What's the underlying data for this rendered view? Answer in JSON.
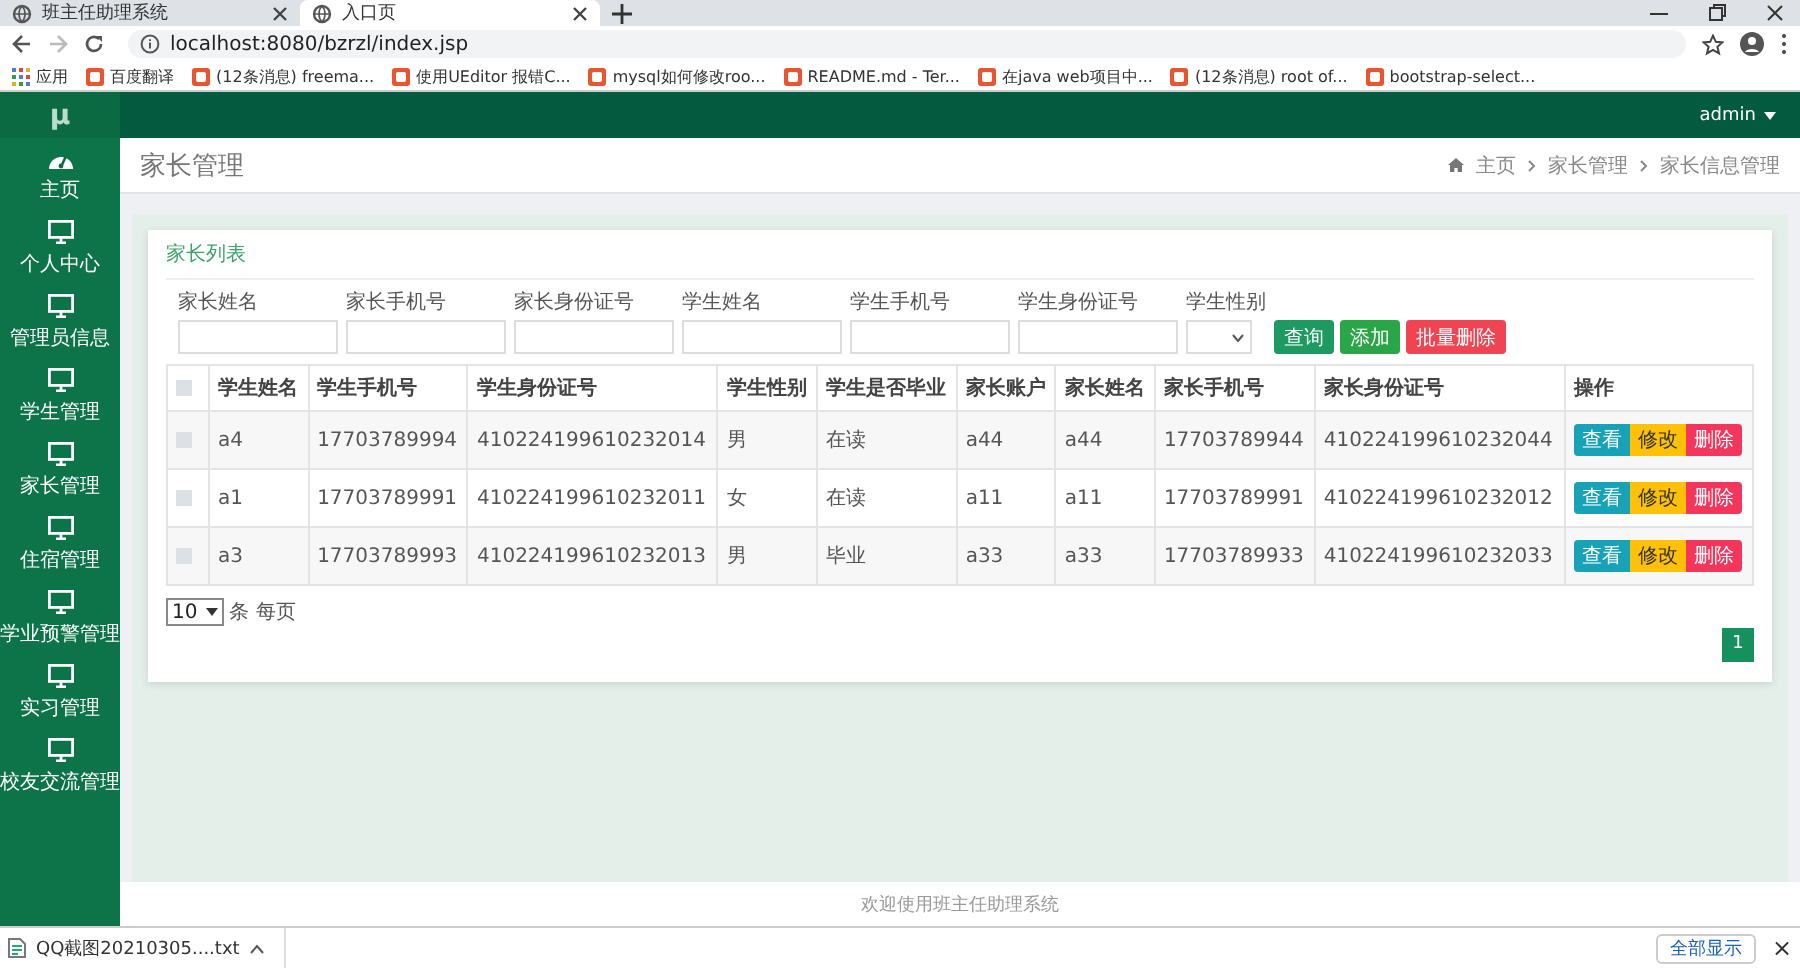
{
  "browser": {
    "tabs": [
      {
        "title": "班主任助理系统",
        "selected": false
      },
      {
        "title": "入口页",
        "selected": true
      }
    ],
    "url": "localhost:8080/bzrzl/index.jsp",
    "bookmarks": [
      {
        "label": "应用",
        "kind": "apps"
      },
      {
        "label": "百度翻译",
        "kind": "site"
      },
      {
        "label": "(12条消息) freema...",
        "kind": "site"
      },
      {
        "label": "使用UEditor 报错C...",
        "kind": "site"
      },
      {
        "label": "mysql如何修改roo...",
        "kind": "site"
      },
      {
        "label": "README.md - Ter...",
        "kind": "site"
      },
      {
        "label": "在java web项目中...",
        "kind": "site"
      },
      {
        "label": "(12条消息) root of...",
        "kind": "site"
      },
      {
        "label": "bootstrap-select...",
        "kind": "site"
      }
    ]
  },
  "app": {
    "logo": "μ",
    "user": "admin",
    "sidebar": {
      "items": [
        {
          "label": "主页",
          "kind": "dashboard"
        },
        {
          "label": "个人中心",
          "kind": "monitor"
        },
        {
          "label": "管理员信息",
          "kind": "monitor"
        },
        {
          "label": "学生管理",
          "kind": "monitor"
        },
        {
          "label": "家长管理",
          "kind": "monitor"
        },
        {
          "label": "住宿管理",
          "kind": "monitor"
        },
        {
          "label": "学业预警管理",
          "kind": "monitor"
        },
        {
          "label": "实习管理",
          "kind": "monitor"
        },
        {
          "label": "校友交流管理",
          "kind": "monitor"
        }
      ]
    },
    "page_title": "家长管理",
    "breadcrumb": [
      "主页",
      "家长管理",
      "家长信息管理"
    ],
    "card_title": "家长列表",
    "filters": [
      {
        "label": "家长姓名",
        "kind": "text"
      },
      {
        "label": "家长手机号",
        "kind": "text"
      },
      {
        "label": "家长身份证号",
        "kind": "text"
      },
      {
        "label": "学生姓名",
        "kind": "text"
      },
      {
        "label": "学生手机号",
        "kind": "text"
      },
      {
        "label": "学生身份证号",
        "kind": "text"
      },
      {
        "label": "学生性别",
        "kind": "select"
      }
    ],
    "filter_buttons": [
      {
        "label": "查询",
        "kind": "query"
      },
      {
        "label": "添加",
        "kind": "add"
      },
      {
        "label": "批量删除",
        "kind": "delete"
      }
    ],
    "table": {
      "header_checked": false,
      "columns": [
        "学生姓名",
        "学生手机号",
        "学生身份证号",
        "学生性别",
        "学生是否毕业",
        "家长账户",
        "家长姓名",
        "家长手机号",
        "家长身份证号",
        "操作"
      ],
      "rows": [
        {
          "checked": false,
          "cells": [
            "a4",
            "17703789994",
            "410224199610232014",
            "男",
            "在读",
            "a44",
            "a44",
            "17703789944",
            "410224199610232044"
          ],
          "actions": [
            {
              "label": "查看",
              "kind": "view"
            },
            {
              "label": "修改",
              "kind": "edit"
            },
            {
              "label": "删除",
              "kind": "delete"
            }
          ]
        },
        {
          "checked": false,
          "cells": [
            "a1",
            "17703789991",
            "410224199610232011",
            "女",
            "在读",
            "a11",
            "a11",
            "17703789991",
            "410224199610232012"
          ],
          "actions": [
            {
              "label": "查看",
              "kind": "view"
            },
            {
              "label": "修改",
              "kind": "edit"
            },
            {
              "label": "删除",
              "kind": "delete"
            }
          ]
        },
        {
          "checked": false,
          "cells": [
            "a3",
            "17703789993",
            "410224199610232013",
            "男",
            "毕业",
            "a33",
            "a33",
            "17703789933",
            "410224199610232033"
          ],
          "actions": [
            {
              "label": "查看",
              "kind": "view"
            },
            {
              "label": "修改",
              "kind": "edit"
            },
            {
              "label": "删除",
              "kind": "delete"
            }
          ]
        }
      ]
    },
    "page_size": "10",
    "page_size_label": "条 每页",
    "pages": [
      {
        "label": "1",
        "selected": true
      }
    ],
    "footer": "欢迎使用班主任助理系统"
  },
  "download_bar": {
    "file": "QQ截图20210305....txt",
    "show_all": "全部显示",
    "close": "×"
  }
}
